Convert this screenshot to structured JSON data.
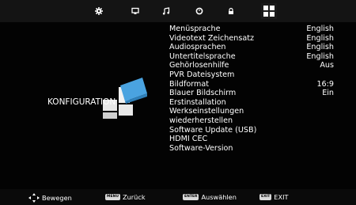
{
  "tabs": [
    {
      "icon": "picture-gear-icon"
    },
    {
      "icon": "monitor-icon"
    },
    {
      "icon": "music-note-icon"
    },
    {
      "icon": "clock-icon"
    },
    {
      "icon": "lock-icon"
    },
    {
      "icon": "settings-grid-icon",
      "active": true
    }
  ],
  "section": {
    "title": "KONFIGURATION"
  },
  "menu": {
    "items": [
      {
        "label": "Menüsprache",
        "value": "English"
      },
      {
        "label": "Videotext Zeichensatz",
        "value": "English"
      },
      {
        "label": "Audiosprachen",
        "value": "English"
      },
      {
        "label": "Untertitelsprache",
        "value": "English"
      },
      {
        "label": "Gehörlosenhilfe",
        "value": "Aus"
      },
      {
        "label": "PVR Dateisystem",
        "value": ""
      },
      {
        "label": "Bildformat",
        "value": "16:9"
      },
      {
        "label": "Blauer Bildschirm",
        "value": "Ein"
      },
      {
        "label": "Erstinstallation",
        "value": ""
      },
      {
        "label": "Werkseinstellungen",
        "value": ""
      },
      {
        "label": "wiederherstellen",
        "value": ""
      },
      {
        "label": "Software Update (USB)",
        "value": ""
      },
      {
        "label": "HDMI CEC",
        "value": ""
      },
      {
        "label": "Software-Version",
        "value": ""
      }
    ]
  },
  "footer": {
    "move_label": "Bewegen",
    "back_key": "MENU",
    "back_label": "Zurück",
    "select_key": "ENTER",
    "select_label": "Auswählen",
    "exit_key": "EXIT",
    "exit_label": "EXIT"
  },
  "colors": {
    "background": "#000000",
    "topbar": "#141414",
    "logo_blue": "#4aa3e0",
    "text": "#ffffff"
  }
}
